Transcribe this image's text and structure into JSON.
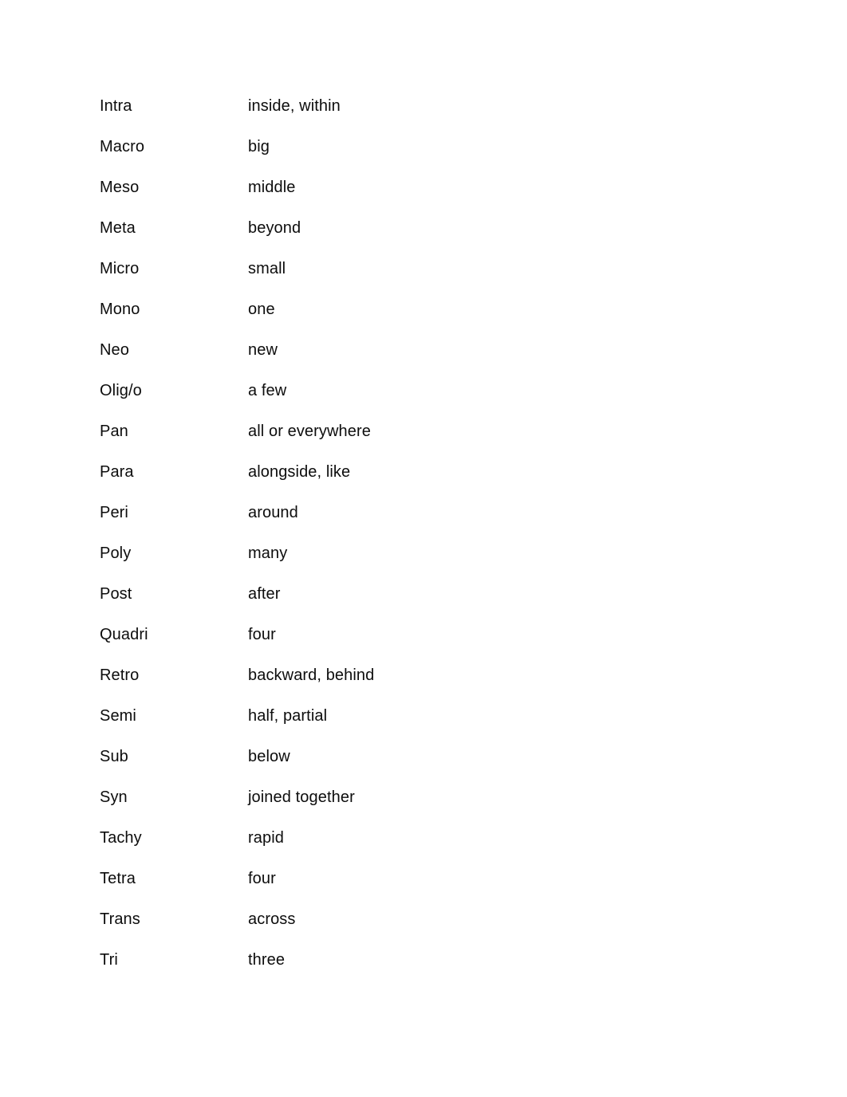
{
  "document": {
    "background_color": "#ffffff",
    "text_color": "#0d0d0d",
    "column_headers": {
      "term": "",
      "definition": ""
    },
    "rows": [
      {
        "term": "Intra",
        "definition": "inside, within"
      },
      {
        "term": "Macro",
        "definition": "big"
      },
      {
        "term": "Meso",
        "definition": "middle"
      },
      {
        "term": "Meta",
        "definition": "beyond"
      },
      {
        "term": "Micro",
        "definition": "small"
      },
      {
        "term": "Mono",
        "definition": "one"
      },
      {
        "term": "Neo",
        "definition": "new"
      },
      {
        "term": "Olig/o",
        "definition": "a few"
      },
      {
        "term": "Pan",
        "definition": "all or everywhere"
      },
      {
        "term": "Para",
        "definition": "alongside, like"
      },
      {
        "term": "Peri",
        "definition": "around"
      },
      {
        "term": "Poly",
        "definition": "many"
      },
      {
        "term": "Post",
        "definition": "after"
      },
      {
        "term": "Quadri",
        "definition": "four"
      },
      {
        "term": "Retro",
        "definition": "backward, behind"
      },
      {
        "term": "Semi",
        "definition": "half, partial"
      },
      {
        "term": "Sub",
        "definition": "below"
      },
      {
        "term": "Syn",
        "definition": "joined together"
      },
      {
        "term": "Tachy",
        "definition": "rapid"
      },
      {
        "term": "Tetra",
        "definition": "four"
      },
      {
        "term": "Trans",
        "definition": "across"
      },
      {
        "term": "Tri",
        "definition": "three"
      }
    ]
  }
}
